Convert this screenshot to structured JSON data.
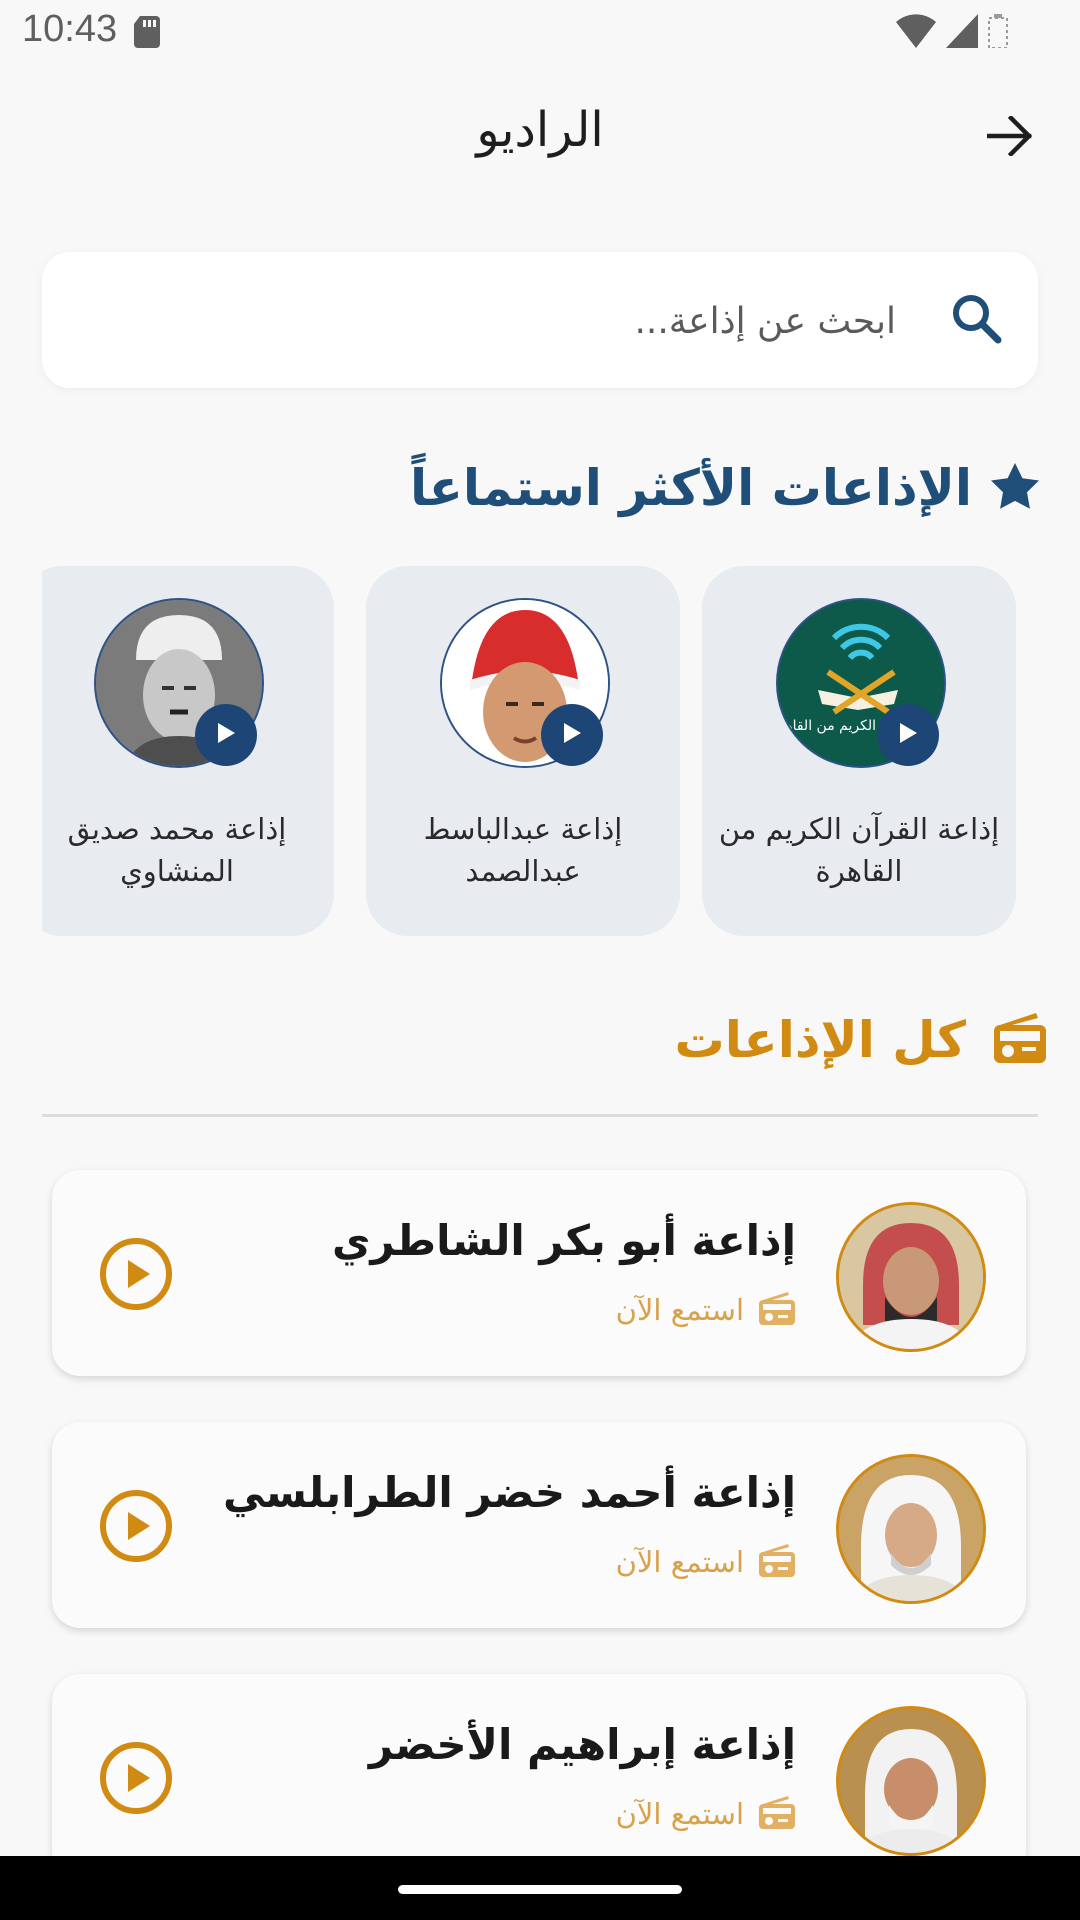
{
  "status": {
    "time": "10:43"
  },
  "header": {
    "title": "الراديو"
  },
  "search": {
    "placeholder": "ابحث عن إذاعة..."
  },
  "popular": {
    "title": "الإذاعات الأكثر استماعاً",
    "cards": [
      {
        "label": "إذاعة القرآن الكريم من القاهرة",
        "logo_text": "إذاعة القرآن الكريم من القاهرة"
      },
      {
        "label": "إذاعة عبدالباسط عبدالصمد"
      },
      {
        "label": "إذاعة محمد صديق المنشاوي"
      }
    ]
  },
  "all": {
    "title": "كل الإذاعات",
    "items": [
      {
        "title": "إذاعة أبو بكر الشاطري",
        "subtitle": "استمع الآن"
      },
      {
        "title": "إذاعة أحمد خضر الطرابلسي",
        "subtitle": "استمع الآن"
      },
      {
        "title": "إذاعة إبراهيم الأخضر",
        "subtitle": "استمع الآن"
      }
    ]
  },
  "icons": {
    "back": "arrow-right-icon",
    "search": "search-icon",
    "popular": "star-icon",
    "all": "radio-icon",
    "play": "play-circle-icon"
  },
  "colors": {
    "primary_blue": "#1f4e79",
    "accent_orange": "#d18a12",
    "card_bg": "#e8ebef"
  }
}
